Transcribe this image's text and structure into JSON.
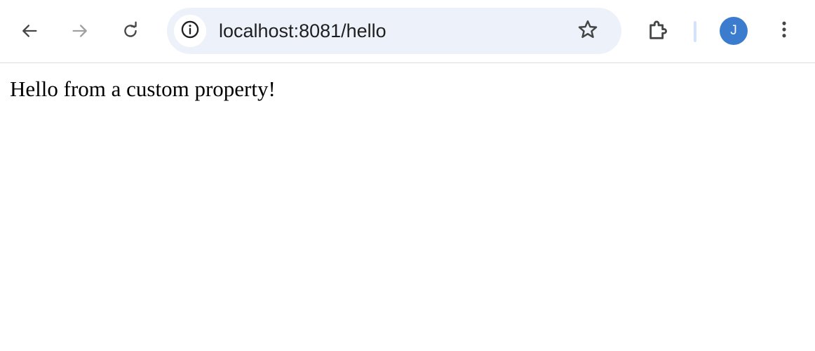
{
  "browser": {
    "url": "localhost:8081/hello",
    "profile_initial": "J",
    "colors": {
      "omnibox_bg": "#edf2fa",
      "avatar_bg": "#3b7ccf",
      "icon": "#444746",
      "icon_disabled": "#a0a0a0",
      "divider": "#d3e3fd"
    },
    "icons": {
      "back": "arrow-left-icon",
      "forward": "arrow-right-icon",
      "reload": "reload-icon",
      "site_info": "info-icon",
      "bookmark": "star-icon",
      "extensions": "puzzle-icon",
      "menu": "kebab-menu-icon"
    }
  },
  "page": {
    "message": "Hello from a custom property!"
  }
}
